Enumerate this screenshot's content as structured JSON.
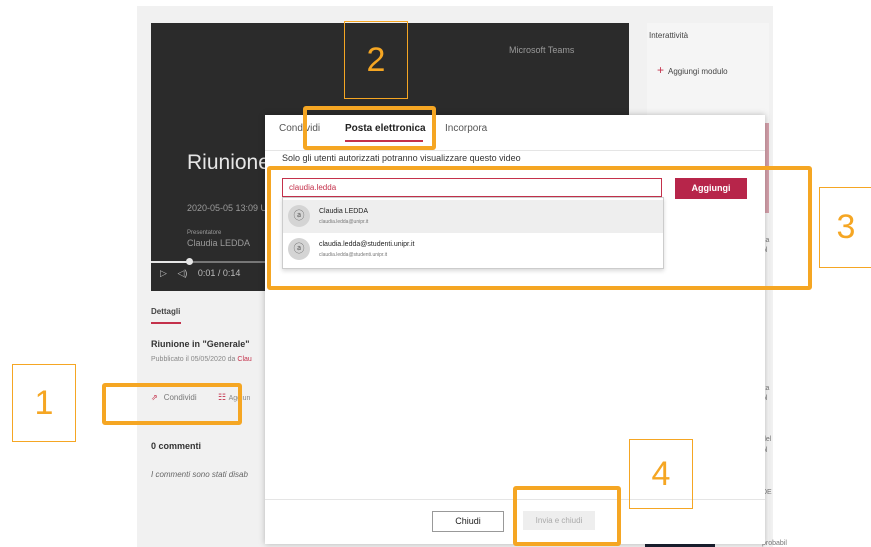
{
  "video": {
    "brand": "Microsoft Teams",
    "title": "Riunione",
    "date": "2020-05-05 13:09 U",
    "presenter_label": "Presentatore",
    "presenter_name": "Claudia LEDDA",
    "time": "0:01 / 0:14",
    "progress_fraction": 0.08
  },
  "side_panel": {
    "title": "Interattività",
    "add_module": "Aggiungi modulo",
    "fragments": [
      "sa",
      "ol",
      "ita",
      "ol",
      "del",
      "ol",
      "DE",
      "probabil"
    ]
  },
  "details": {
    "tab_label": "Dettagli",
    "meeting_title": "Riunione in \"Generale\"",
    "published_prefix": "Pubblicato il 05/05/2020 da ",
    "published_author": "Clau",
    "share_label": "Condividi",
    "side_action_fragment": "Aggiun",
    "comments_heading": "0 commenti",
    "comments_disabled": "I commenti sono stati disab"
  },
  "dialog": {
    "tabs": [
      {
        "label": "Condividi",
        "active": false
      },
      {
        "label": "Posta elettronica",
        "active": true
      },
      {
        "label": "Incorpora",
        "active": false
      }
    ],
    "notice": "Solo gli utenti autorizzati potranno visualizzare questo video",
    "email_value": "claudia.ledda",
    "add_button": "Aggiungi",
    "suggestions": [
      {
        "name": "Claudia LEDDA",
        "email": "claudia.ledda@unipr.it"
      },
      {
        "name": "claudia.ledda@studenti.unipr.it",
        "email": "claudia.ledda@studenti.unipr.it"
      }
    ],
    "close_button": "Chiudi",
    "send_button": "Invia e chiudi"
  },
  "callouts": [
    "1",
    "2",
    "3",
    "4"
  ],
  "colors": {
    "accent": "#c4314b",
    "highlight": "#f5a623"
  }
}
